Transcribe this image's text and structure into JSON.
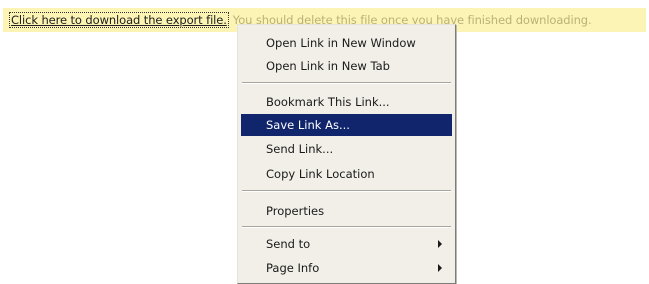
{
  "notice": {
    "link_text": "Click here to download the export file.",
    "message": "You should delete this file once you have finished downloading."
  },
  "context_menu": {
    "items": [
      {
        "label": "Open Link in New Window"
      },
      {
        "label": "Open Link in New Tab"
      },
      {
        "label": "Bookmark This Link..."
      },
      {
        "label": "Save Link As...",
        "highlighted": true
      },
      {
        "label": "Send Link..."
      },
      {
        "label": "Copy Link Location"
      },
      {
        "label": "Properties"
      },
      {
        "label": "Send to",
        "submenu": true
      },
      {
        "label": "Page Info",
        "submenu": true
      }
    ]
  },
  "colors": {
    "notice_background": "#fcf4b4",
    "highlight": "#11256c",
    "menu_background": "#f1efe8"
  }
}
